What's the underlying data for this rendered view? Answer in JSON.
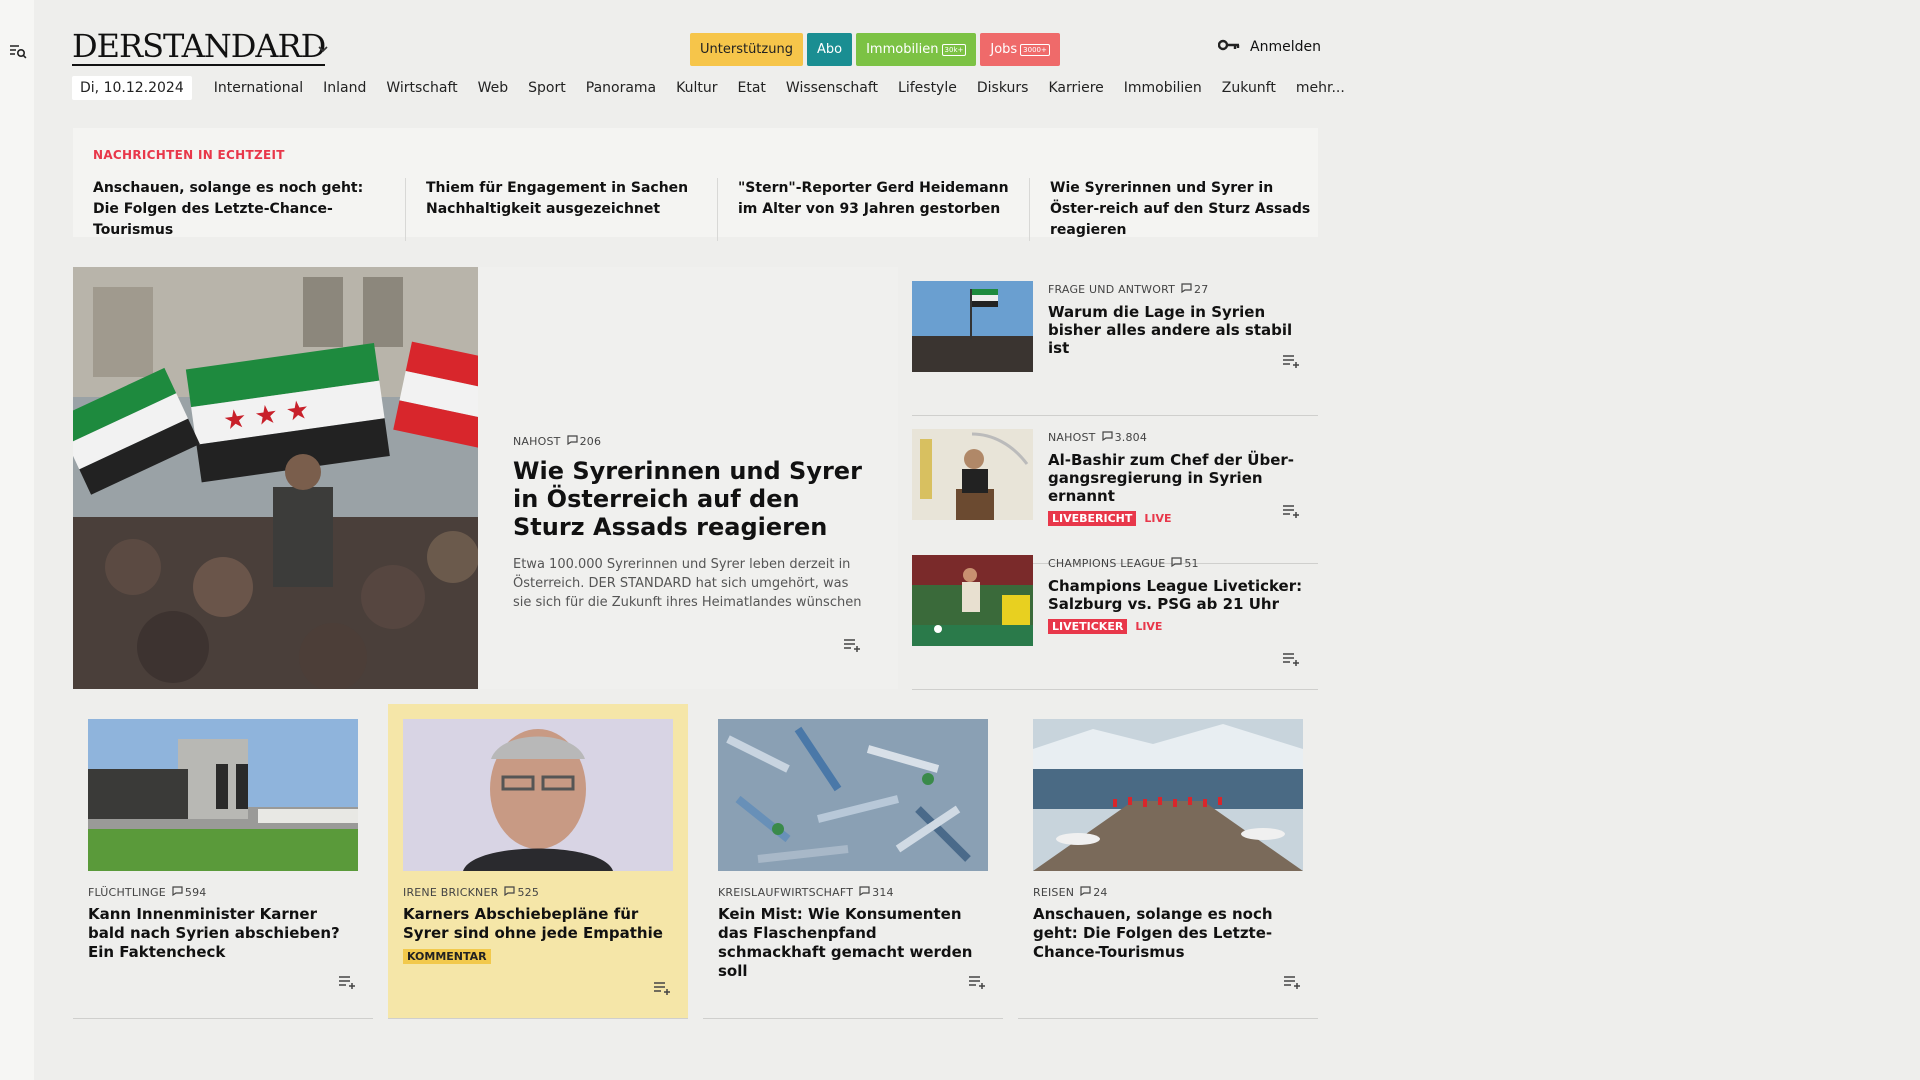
{
  "header": {
    "logo": "DERSTANDARD",
    "pills": [
      {
        "label": "Unterstützung",
        "bg": "#f6c54a",
        "fg": "#222",
        "badge": ""
      },
      {
        "label": "Abo",
        "bg": "#1a8e92",
        "fg": "#fff",
        "badge": ""
      },
      {
        "label": "Immobilien",
        "bg": "#7cc244",
        "fg": "#fff",
        "badge": "30k+"
      },
      {
        "label": "Jobs",
        "bg": "#ef6a6a",
        "fg": "#fff",
        "badge": "3000+"
      }
    ],
    "login_label": "Anmelden"
  },
  "nav": {
    "date": "Di, 10.12.2024",
    "items": [
      "International",
      "Inland",
      "Wirtschaft",
      "Web",
      "Sport",
      "Panorama",
      "Kultur",
      "Etat",
      "Wissenschaft",
      "Lifestyle",
      "Diskurs",
      "Karriere",
      "Immobilien",
      "Zukunft",
      "mehr..."
    ]
  },
  "ticker": {
    "title": "NACHRICHTEN IN ECHTZEIT",
    "items": [
      "Anschauen, solange es noch geht: Die Folgen des Letzte-Chance-Tourismus",
      "Thiem für Engagement in Sachen Nachhaltigkeit ausgezeichnet",
      "\"Stern\"-Reporter Gerd Heidemann im Alter von 93 Jahren gestorben",
      "Wie Syrerinnen und Syrer in Öster-reich auf den Sturz Assads reagieren"
    ]
  },
  "lead": {
    "kicker": "NAHOST",
    "comments": "206",
    "title": "Wie Syrerinnen und Syrer in Österreich auf den Sturz Assads reagieren",
    "teaser": "Etwa 100.000 Syrerinnen und Syrer leben derzeit in Österreich. DER STANDARD hat sich umgehört, was sie sich für die Zukunft ihres Heimatlandes wünschen"
  },
  "side": [
    {
      "kicker": "FRAGE UND ANTWORT",
      "comments": "27",
      "title": "Warum die Lage in Syrien bisher alles andere als stabil ist",
      "tag": "",
      "live": ""
    },
    {
      "kicker": "NAHOST",
      "comments": "3.804",
      "title": "Al-Bashir zum Chef der Über-gangsregierung in Syrien ernannt",
      "tag": "LIVEBERICHT",
      "live": "LIVE"
    },
    {
      "kicker": "CHAMPIONS LEAGUE",
      "comments": "51",
      "title": "Champions League Liveticker: Salzburg vs. PSG ab 21 Uhr",
      "tag": "LIVETICKER",
      "live": "LIVE"
    }
  ],
  "cards": [
    {
      "kicker": "FLÜCHTLINGE",
      "comments": "594",
      "title": "Kann Innenminister Karner bald nach Syrien abschieben? Ein Faktencheck",
      "tag": ""
    },
    {
      "kicker": "IRENE BRICKNER",
      "comments": "525",
      "title": "Karners Abschiebepläne für Syrer sind ohne jede Empathie",
      "tag": "KOMMENTAR"
    },
    {
      "kicker": "KREISLAUFWIRTSCHAFT",
      "comments": "314",
      "title": "Kein Mist: Wie Konsumenten das Flaschenpfand schmackhaft gemacht werden soll",
      "tag": ""
    },
    {
      "kicker": "REISEN",
      "comments": "24",
      "title": "Anschauen, solange es noch geht: Die Folgen des Letzte-Chance-Tourismus",
      "tag": ""
    }
  ]
}
